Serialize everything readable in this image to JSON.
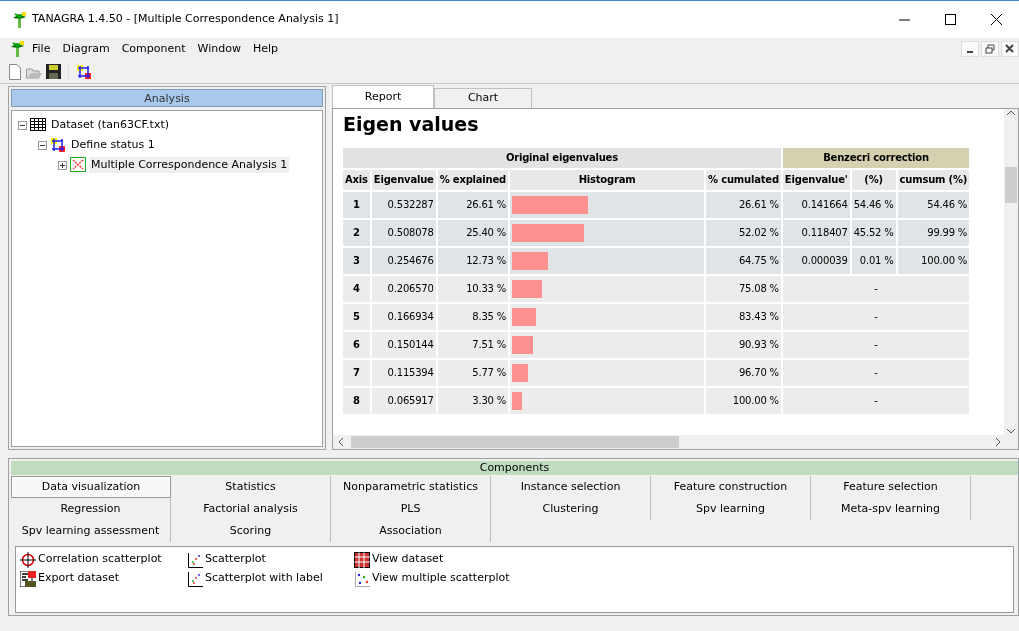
{
  "window": {
    "title": "TANAGRA 1.4.50 - [Multiple Correspondence Analysis 1]"
  },
  "menu": [
    "File",
    "Diagram",
    "Component",
    "Window",
    "Help"
  ],
  "analysis": {
    "title": "Analysis",
    "tree": [
      {
        "label": "Dataset (tan63CF.txt)",
        "kind": "dataset",
        "expanded": true,
        "selected": false,
        "children": [
          {
            "label": "Define status 1",
            "kind": "status",
            "expanded": true,
            "selected": false,
            "children": [
              {
                "label": "Multiple Correspondence Analysis 1",
                "kind": "mca",
                "expanded": false,
                "selected": true
              }
            ]
          }
        ]
      }
    ]
  },
  "view_tabs": [
    {
      "label": "Report",
      "selected": true
    },
    {
      "label": "Chart",
      "selected": false
    }
  ],
  "report": {
    "title": "Eigen values",
    "group_headers": [
      "Original eigenvalues",
      "Benzecri correction"
    ],
    "columns": [
      "Axis",
      "Eigenvalue",
      "% explained",
      "Histogram",
      "% cumulated",
      "Eigenvalue'",
      "(%)",
      "cumsum (%)"
    ],
    "rows": [
      {
        "axis": "1",
        "eigenvalue": "0.532287",
        "explained": "26.61 %",
        "level": 0.4,
        "cumulated": "26.61 %",
        "highlighted": true,
        "benzecri": [
          "0.141664",
          "54.46 %",
          "54.46 %"
        ]
      },
      {
        "axis": "2",
        "eigenvalue": "0.508078",
        "explained": "25.40 %",
        "level": 0.38,
        "cumulated": "52.02 %",
        "highlighted": true,
        "benzecri": [
          "0.118407",
          "45.52 %",
          "99.99 %"
        ]
      },
      {
        "axis": "3",
        "eigenvalue": "0.254676",
        "explained": "12.73 %",
        "level": 0.19,
        "cumulated": "64.75 %",
        "highlighted": true,
        "benzecri": [
          "0.000039",
          "0.01 %",
          "100.00 %"
        ]
      },
      {
        "axis": "4",
        "eigenvalue": "0.206570",
        "explained": "10.33 %",
        "level": 0.155,
        "cumulated": "75.08 %",
        "highlighted": false,
        "benzecri_none": "-"
      },
      {
        "axis": "5",
        "eigenvalue": "0.166934",
        "explained": "8.35 %",
        "level": 0.125,
        "cumulated": "83.43 %",
        "highlighted": false,
        "benzecri_none": "-"
      },
      {
        "axis": "6",
        "eigenvalue": "0.150144",
        "explained": "7.51 %",
        "level": 0.11,
        "cumulated": "90.93 %",
        "highlighted": false,
        "benzecri_none": "-"
      },
      {
        "axis": "7",
        "eigenvalue": "0.115394",
        "explained": "5.77 %",
        "level": 0.085,
        "cumulated": "96.70 %",
        "highlighted": false,
        "benzecri_none": "-"
      },
      {
        "axis": "8",
        "eigenvalue": "0.065917",
        "explained": "3.30 %",
        "level": 0.05,
        "cumulated": "100.00 %",
        "highlighted": false,
        "benzecri_none": "-"
      }
    ]
  },
  "components": {
    "title": "Components",
    "tabs": [
      {
        "label": "Data visualization",
        "selected": true
      },
      {
        "label": "Statistics",
        "selected": false
      },
      {
        "label": "Nonparametric statistics",
        "selected": false
      },
      {
        "label": "Instance selection",
        "selected": false
      },
      {
        "label": "Feature construction",
        "selected": false
      },
      {
        "label": "Feature selection",
        "selected": false
      },
      {
        "label": "Regression",
        "selected": false
      },
      {
        "label": "Factorial analysis",
        "selected": false
      },
      {
        "label": "PLS",
        "selected": false
      },
      {
        "label": "Clustering",
        "selected": false
      },
      {
        "label": "Spv learning",
        "selected": false
      },
      {
        "label": "Meta-spv learning",
        "selected": false
      },
      {
        "label": "Spv learning assessment",
        "selected": false
      },
      {
        "label": "Scoring",
        "selected": false
      },
      {
        "label": "Association",
        "selected": false
      }
    ],
    "items": [
      {
        "label": "Correlation scatterplot",
        "kind": "crosshair"
      },
      {
        "label": "Export dataset",
        "kind": "export"
      },
      {
        "label": "Scatterplot",
        "kind": "scatter"
      },
      {
        "label": "Scatterplot with label",
        "kind": "scatter"
      },
      {
        "label": "View dataset",
        "kind": "grid"
      },
      {
        "label": "View multiple scatterplot",
        "kind": "multi"
      }
    ]
  }
}
